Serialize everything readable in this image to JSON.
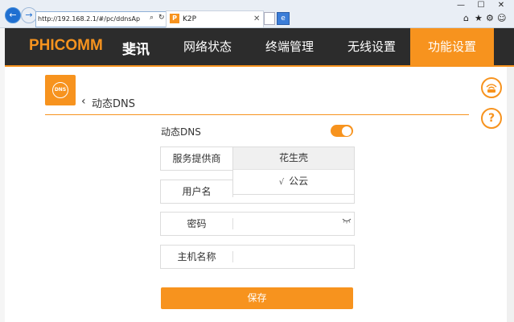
{
  "browser": {
    "url": "http://192.168.2.1/#/pc/ddnsAp",
    "tab_title": "K2P",
    "tab_close": "✕",
    "minimize": "—",
    "maximize": "☐",
    "close": "✕"
  },
  "header": {
    "logo": "PHICOMM",
    "logo_cn": "斐讯",
    "nav": [
      {
        "label": "网络状态"
      },
      {
        "label": "终端管理"
      },
      {
        "label": "无线设置"
      },
      {
        "label": "功能设置"
      }
    ],
    "accent": "#f7931e"
  },
  "page": {
    "icon_text": "DNS",
    "back_label": "‹",
    "title": "动态DNS",
    "switch_label": "动态DNS",
    "switch_on": true,
    "fields": [
      {
        "label": "服务提供商",
        "value": ""
      },
      {
        "label": "用户名",
        "value": ""
      },
      {
        "label": "密码",
        "value": ""
      },
      {
        "label": "主机名称",
        "value": ""
      }
    ],
    "dropdown": {
      "options": [
        "花生壳",
        "公云"
      ],
      "checked_mark": "√"
    },
    "save_label": "保存"
  },
  "side": {
    "help": "?"
  }
}
